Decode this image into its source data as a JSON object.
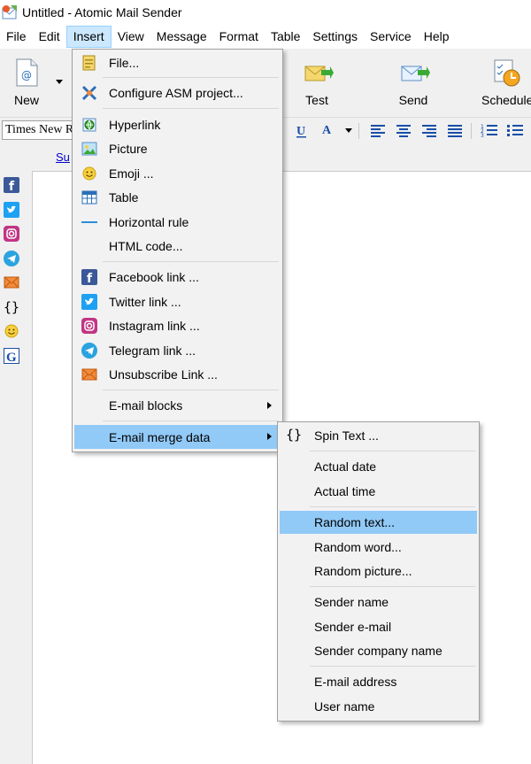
{
  "window": {
    "title": "Untitled - Atomic Mail Sender"
  },
  "menubar": [
    "File",
    "Edit",
    "Insert",
    "View",
    "Message",
    "Format",
    "Table",
    "Settings",
    "Service",
    "Help"
  ],
  "toolbar": {
    "new": "New",
    "test": "Test",
    "send": "Send",
    "schedule": "Schedule"
  },
  "format": {
    "font": "Times New Roman"
  },
  "editor": {
    "link_partial": "Su"
  },
  "insert_menu": {
    "file": "File...",
    "configure": "Configure ASM project...",
    "hyperlink": "Hyperlink",
    "picture": "Picture",
    "emoji": "Emoji ...",
    "table": "Table",
    "hrule": "Horizontal rule",
    "html": "HTML code...",
    "facebook": "Facebook link ...",
    "twitter": "Twitter link ...",
    "instagram": "Instagram link ...",
    "telegram": "Telegram link ...",
    "unsubscribe": "Unsubscribe Link ...",
    "blocks": "E-mail blocks",
    "merge": "E-mail merge data"
  },
  "merge_menu": {
    "spin": "Spin Text ...",
    "date": "Actual date",
    "time": "Actual time",
    "rtext": "Random text...",
    "rword": "Random word...",
    "rpic": "Random picture...",
    "sname": "Sender name",
    "semail": "Sender e-mail",
    "scompany": "Sender company name",
    "email": "E-mail address",
    "user": "User name"
  },
  "colors": {
    "highlight": "#91c9f7",
    "menu_active": "#cce8ff",
    "link": "#0000cc"
  }
}
